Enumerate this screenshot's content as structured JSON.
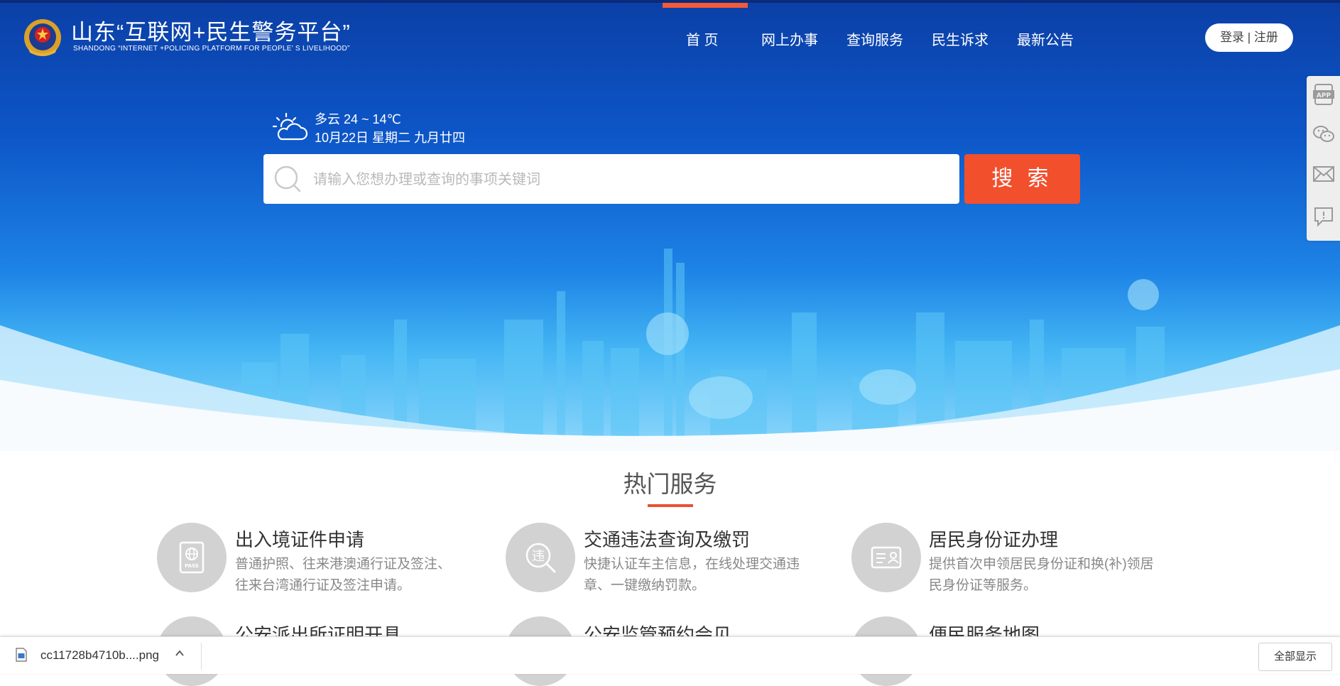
{
  "header": {
    "brand_cn": "山东“互联网+民生警务平台”",
    "brand_en": "SHANDONG  “INTERNET +POLICING PLATFORM FOR PEOPLE’ S LIVELIHOOD”",
    "nav": [
      "首  页",
      "网上办事",
      "查询服务",
      "民生诉求",
      "最新公告"
    ],
    "active_nav": "首  页",
    "login_label": "登录 | 注册"
  },
  "weather": {
    "temp": "多云 24 ~ 14℃",
    "date": "10月22日 星期二 九月廿四",
    "icon": "cloud-sun-icon"
  },
  "search": {
    "placeholder": "请输入您想办理或查询的事项关键词",
    "button_label": "搜 索"
  },
  "side_toolbar": [
    "app-icon",
    "wechat-icon",
    "mail-icon",
    "feedback-icon"
  ],
  "hot_services": {
    "title": "热门服务",
    "items": [
      {
        "title": "出入境证件申请",
        "desc_line1": "普通护照、往来港澳通行证及签注、",
        "desc_line2": "往来台湾通行证及签注申请。",
        "icon": "passport-icon"
      },
      {
        "title": "交通违法查询及缴罚",
        "desc_line1": "快捷认证车主信息，在线处理交通违",
        "desc_line2": "章、一键缴纳罚款。",
        "icon": "traffic-violation-icon"
      },
      {
        "title": "居民身份证办理",
        "desc_line1": "提供首次申领居民身份证和换(补)领居",
        "desc_line2": "民身份证等服务。",
        "icon": "id-card-icon"
      },
      {
        "title": "公安派出所证明开具",
        "icon": "certificate-icon"
      },
      {
        "title": "公安监管预约会见",
        "icon": "appointment-icon"
      },
      {
        "title": "便民服务地图",
        "icon": "map-icon"
      }
    ]
  },
  "download_bar": {
    "file_name": "cc11728b4710b....png",
    "show_all_label": "全部显示"
  },
  "colors": {
    "accent": "#f24f2d",
    "hero_blue": "#0d56c8",
    "icon_grey": "#d2d2d2"
  }
}
